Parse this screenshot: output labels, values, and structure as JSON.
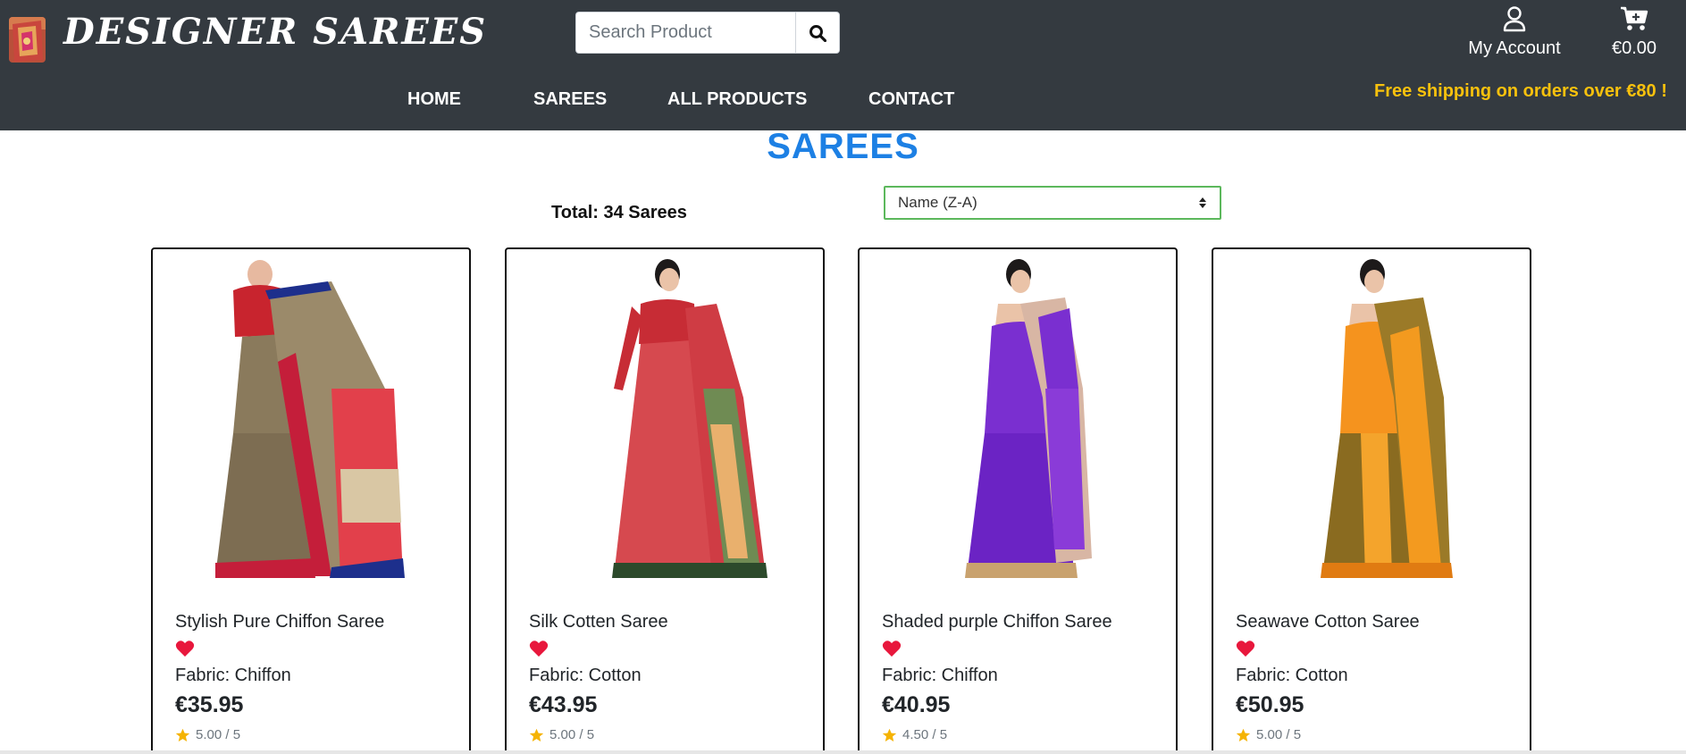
{
  "header": {
    "brand": "DESIGNER SAREES",
    "search_placeholder": "Search Product",
    "account_label": "My Account",
    "cart_total": "€0.00",
    "free_shipping": "Free shipping on orders over €80 !",
    "nav": [
      "HOME",
      "SAREES",
      "ALL PRODUCTS",
      "CONTACT"
    ]
  },
  "page": {
    "title": "SAREES",
    "total": "Total: 34 Sarees",
    "sort_selected": "Name (Z-A)"
  },
  "products": [
    {
      "name": "Stylish Pure Chiffon Saree",
      "fabric": "Fabric: Chiffon",
      "price": "€35.95",
      "rating": "5.00 / 5"
    },
    {
      "name": "Silk Cotten Saree",
      "fabric": "Fabric: Cotton",
      "price": "€43.95",
      "rating": "5.00 / 5"
    },
    {
      "name": "Shaded purple Chiffon Saree",
      "fabric": "Fabric: Chiffon",
      "price": "€40.95",
      "rating": "4.50 / 5"
    },
    {
      "name": "Seawave Cotton Saree",
      "fabric": "Fabric: Cotton",
      "price": "€50.95",
      "rating": "5.00 / 5"
    }
  ],
  "colors": {
    "header_bg": "#343a40",
    "accent_blue": "#1d80e4",
    "shipping_yellow": "#f8c10d",
    "heart_red": "#e8173c",
    "star_gold": "#f5b301",
    "sort_border": "#5cb85c"
  },
  "icons": [
    "search-icon",
    "user-icon",
    "cart-icon",
    "heart-icon",
    "star-icon",
    "sort-arrows-icon"
  ]
}
